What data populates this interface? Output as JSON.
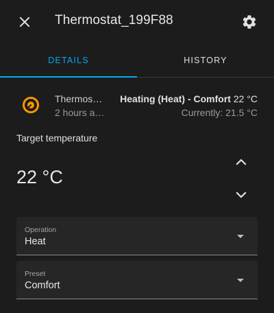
{
  "header": {
    "title": "Thermostat_199F88",
    "close_icon": "close-icon",
    "settings_icon": "gear-icon"
  },
  "tabs": [
    {
      "label": "DETAILS",
      "active": true
    },
    {
      "label": "HISTORY",
      "active": false
    }
  ],
  "entity": {
    "icon": "thermostat-icon",
    "icon_color": "#ff9800",
    "name": "Thermos…",
    "time": "2 hours a…",
    "state_mode": "Heating (Heat) - Comfort",
    "state_value": "22 °C",
    "current": "Currently: 21.5 °C"
  },
  "target": {
    "label": "Target temperature",
    "value": "22 °C"
  },
  "operation": {
    "label": "Operation",
    "value": "Heat"
  },
  "preset": {
    "label": "Preset",
    "value": "Comfort"
  },
  "colors": {
    "accent": "#03a9f4",
    "background": "#1c1c1c",
    "heating": "#ff9800"
  }
}
